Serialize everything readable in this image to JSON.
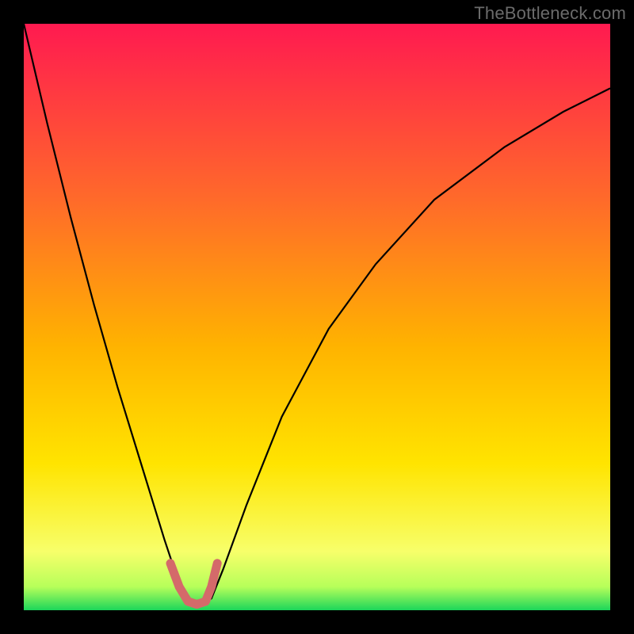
{
  "watermark": "TheBottleneck.com",
  "chart_data": {
    "type": "line",
    "title": "",
    "xlabel": "",
    "ylabel": "",
    "xlim": [
      0,
      100
    ],
    "ylim": [
      0,
      100
    ],
    "grid": false,
    "legend": false,
    "series": [
      {
        "name": "curve",
        "x": [
          0,
          4,
          8,
          12,
          16,
          20,
          24,
          26,
          28,
          30,
          32,
          34,
          38,
          44,
          52,
          60,
          70,
          82,
          92,
          100
        ],
        "values": [
          100,
          83,
          67,
          52,
          38,
          25,
          12,
          6,
          2,
          1,
          2,
          7,
          18,
          33,
          48,
          59,
          70,
          79,
          85,
          89
        ]
      },
      {
        "name": "highlight",
        "x": [
          25,
          26.5,
          28,
          29.5,
          31,
          32,
          33
        ],
        "values": [
          8,
          4,
          1.5,
          1,
          1.5,
          4,
          8
        ]
      }
    ],
    "gradient_bands": [
      {
        "y": 100,
        "color": "#ff1a50"
      },
      {
        "y": 70,
        "color": "#ff6a2a"
      },
      {
        "y": 45,
        "color": "#ffb300"
      },
      {
        "y": 25,
        "color": "#ffe400"
      },
      {
        "y": 10,
        "color": "#f7ff6a"
      },
      {
        "y": 4,
        "color": "#b7ff5a"
      },
      {
        "y": 0,
        "color": "#1cd65a"
      }
    ],
    "highlight_color": "#d46a6a",
    "curve_color": "#000000",
    "minimum_x": 29.5
  }
}
